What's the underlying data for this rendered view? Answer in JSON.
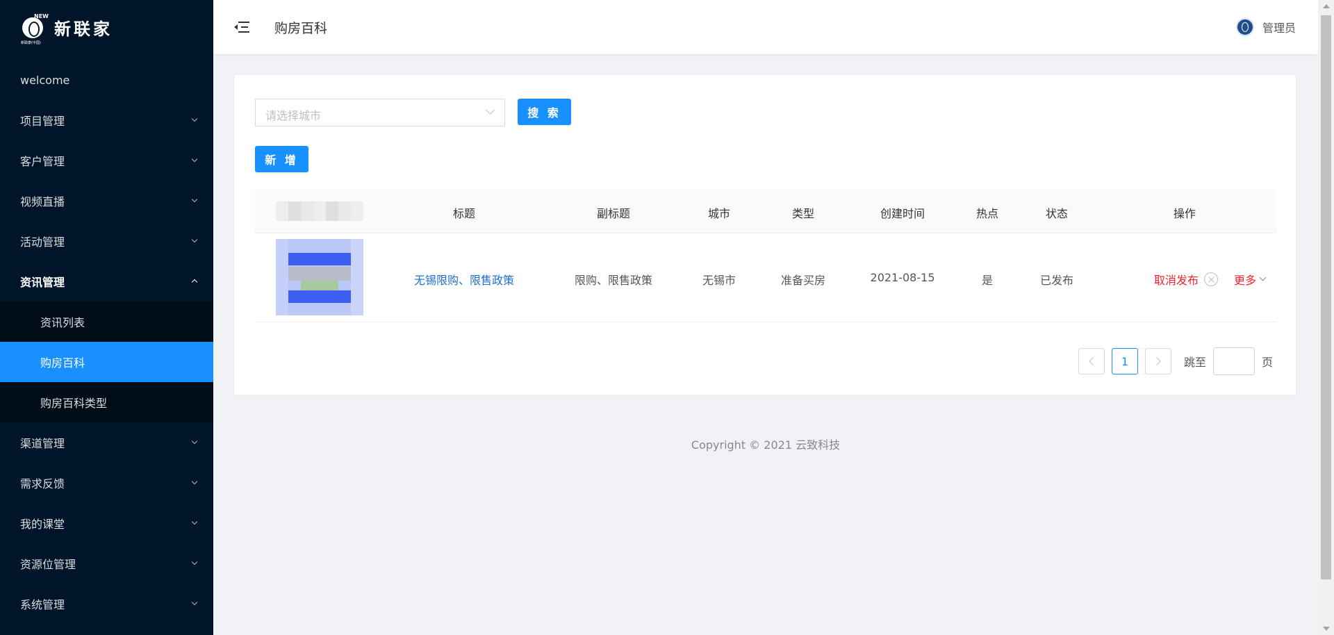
{
  "logo": {
    "text": "新联家",
    "badge": "NEW",
    "sub": "新联康(中国)"
  },
  "sidebar": {
    "items": [
      {
        "label": "welcome"
      },
      {
        "label": "项目管理"
      },
      {
        "label": "客户管理"
      },
      {
        "label": "视频直播"
      },
      {
        "label": "活动管理"
      },
      {
        "label": "资讯管理"
      },
      {
        "label": "渠道管理"
      },
      {
        "label": "需求反馈"
      },
      {
        "label": "我的课堂"
      },
      {
        "label": "资源位管理"
      },
      {
        "label": "系统管理"
      }
    ],
    "submenu": [
      {
        "label": "资讯列表"
      },
      {
        "label": "购房百科"
      },
      {
        "label": "购房百科类型"
      }
    ],
    "active_submenu": "购房百科"
  },
  "header": {
    "title": "购房百科",
    "user": "管理员"
  },
  "filter": {
    "city_placeholder": "请选择城市",
    "search_label": "搜 索",
    "add_label": "新 增"
  },
  "table": {
    "columns": [
      "标题",
      "副标题",
      "城市",
      "类型",
      "创建时间",
      "热点",
      "状态",
      "操作"
    ],
    "rows": [
      {
        "title": "无锡限购、限售政策",
        "subtitle": "限购、限售政策",
        "city": "无锡市",
        "type": "准备买房",
        "created": "2021-08-15",
        "hot": "是",
        "status": "已发布",
        "cancel": "取消发布",
        "more": "更多"
      }
    ]
  },
  "pagination": {
    "current": "1",
    "jump_label": "跳至",
    "page_label": "页"
  },
  "footer": {
    "text": "Copyright © 2021 云致科技"
  },
  "colors": {
    "sidebar_bg": "#001529",
    "primary": "#1890ff",
    "danger": "#f5222d"
  }
}
